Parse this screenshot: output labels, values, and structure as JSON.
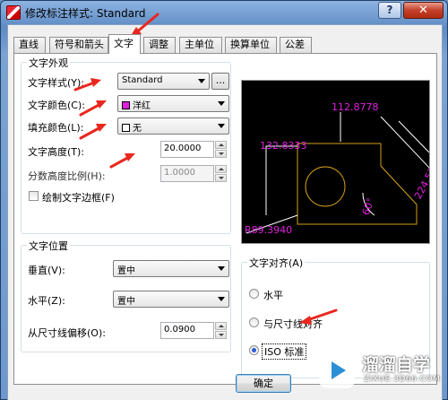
{
  "window": {
    "title": "修改标注样式: Standard",
    "help_label": "?",
    "close_label": "✕"
  },
  "tabs": [
    {
      "label": "直线"
    },
    {
      "label": "符号和箭头"
    },
    {
      "label": "文字"
    },
    {
      "label": "调整"
    },
    {
      "label": "主单位"
    },
    {
      "label": "换算单位"
    },
    {
      "label": "公差"
    }
  ],
  "appearance": {
    "title": "文字外观",
    "style_label": "文字样式(Y):",
    "style_value": "Standard",
    "style_browse": "...",
    "color_label": "文字颜色(C):",
    "color_value": "洋红",
    "color_swatch": "#e020e0",
    "fill_label": "填充颜色(L):",
    "fill_value": "无",
    "height_label": "文字高度(T):",
    "height_value": "20.0000",
    "fraction_label": "分数高度比例(H):",
    "fraction_value": "1.0000",
    "frame_label": "绘制文字边框(F)"
  },
  "placement": {
    "title": "文字位置",
    "vertical_label": "垂直(V):",
    "vertical_value": "置中",
    "horizontal_label": "水平(Z):",
    "horizontal_value": "置中",
    "offset_label": "从尺寸线偏移(O):",
    "offset_value": "0.0900"
  },
  "alignment": {
    "title": "文字对齐(A)",
    "options": [
      {
        "label": "水平",
        "checked": false
      },
      {
        "label": "与尺寸线对齐",
        "checked": false
      },
      {
        "label": "ISO 标准",
        "checked": true
      }
    ]
  },
  "preview": {
    "dim_top": "112.8778",
    "dim_left": "132.8333",
    "dim_right": "224.5272",
    "dim_angle": "60°",
    "dim_radius": "R89.3940",
    "text_color": "#e020e0",
    "line_color": "#ffffff",
    "shape_color": "#d4a017"
  },
  "buttons": {
    "ok_label": "确定"
  },
  "watermark": {
    "brand": "溜溜自学",
    "url": "ZIXUE.3D66.COM"
  },
  "annotation_color": "#e8281e"
}
